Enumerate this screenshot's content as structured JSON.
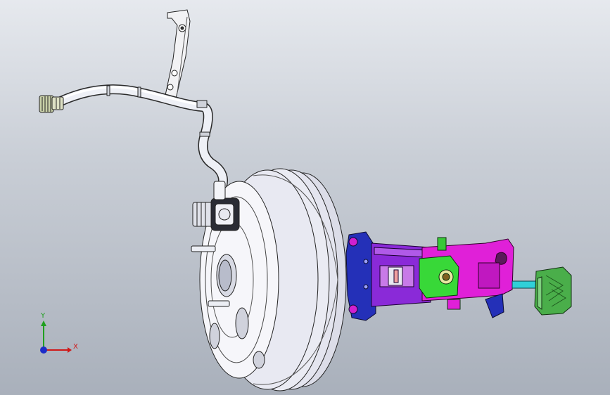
{
  "triad": {
    "x_label": "X",
    "y_label": "Y",
    "x_color": "#d01818",
    "y_color": "#20a020",
    "z_color": "#1c2cc8"
  },
  "colors": {
    "bg_top": "#e6e9ee",
    "bg_bottom": "#a9b0bb",
    "booster": "#e8e9f2",
    "bracket_blue": "#2430b8",
    "arm_magenta": "#e020d8",
    "arm_purple": "#8a2ad8",
    "switch_green": "#38d838",
    "pedal_green": "#4aae4a",
    "rod_cyan": "#30d0d8"
  }
}
